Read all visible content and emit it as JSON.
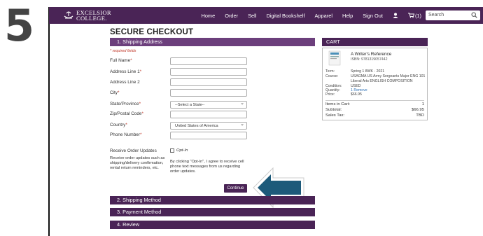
{
  "step_number": "5",
  "header": {
    "logo_line1": "EXCELSIOR",
    "logo_line2": "COLLEGE.",
    "nav": [
      "Home",
      "Order",
      "Sell",
      "Digital Bookshelf",
      "Apparel",
      "Help",
      "Sign Out"
    ],
    "cart_count": "(1)",
    "search_placeholder": "Search",
    "icons": [
      "user-icon",
      "cart-icon",
      "search-icon"
    ]
  },
  "page_title": "SECURE CHECKOUT",
  "sections": {
    "s1": "1. Shipping Address",
    "s2": "2. Shipping Method",
    "s3": "3. Payment Method",
    "s4": "4. Review"
  },
  "form": {
    "required_note": "* required fields",
    "full_name": "Full Name",
    "address1": "Address Line 1",
    "address2": "Address Line 2",
    "city": "City",
    "state": "State/Province",
    "state_value": "--Select a State--",
    "zip": "Zip/Postal Code",
    "country": "Country",
    "country_value": "United States of America",
    "phone": "Phone Number",
    "star": "*",
    "updates_title": "Receive Order Updates",
    "updates_desc": "Receive order updates such as shipping/delivery confirmation, rental return reminders, etc.",
    "opt_in_label": "Opt-In",
    "opt_in_consent": "By clicking \"Opt-In\", I agree to receive cell phone text messages from us regarding order updates.",
    "continue": "Continue"
  },
  "cart": {
    "title": "CART",
    "book_title": "A Writer's Reference",
    "isbn": "ISBN: 9781319057442",
    "term_k": "Term:",
    "term_v": "Spring 1 8WK - 2021",
    "course_k": "Course:",
    "course_v1": "USAGMA US Army Sergeants Major ENG 101",
    "course_v2": "Liberal Arts ENGLISH COMPOSITION",
    "condition_k": "Condition:",
    "condition_v": "USED",
    "quantity_k": "Quantity:",
    "quantity_v": "1 Remove",
    "price_k": "Price:",
    "price_v": "$66.95",
    "items_k": "Items in Cart:",
    "items_v": "1",
    "subtotal_k": "Subtotal:",
    "subtotal_v": "$66.95",
    "tax_k": "Sales Tax:",
    "tax_v": "TBD"
  },
  "colors": {
    "brand_purple": "#4a2456",
    "arrow_blue": "#1d5a7a"
  }
}
